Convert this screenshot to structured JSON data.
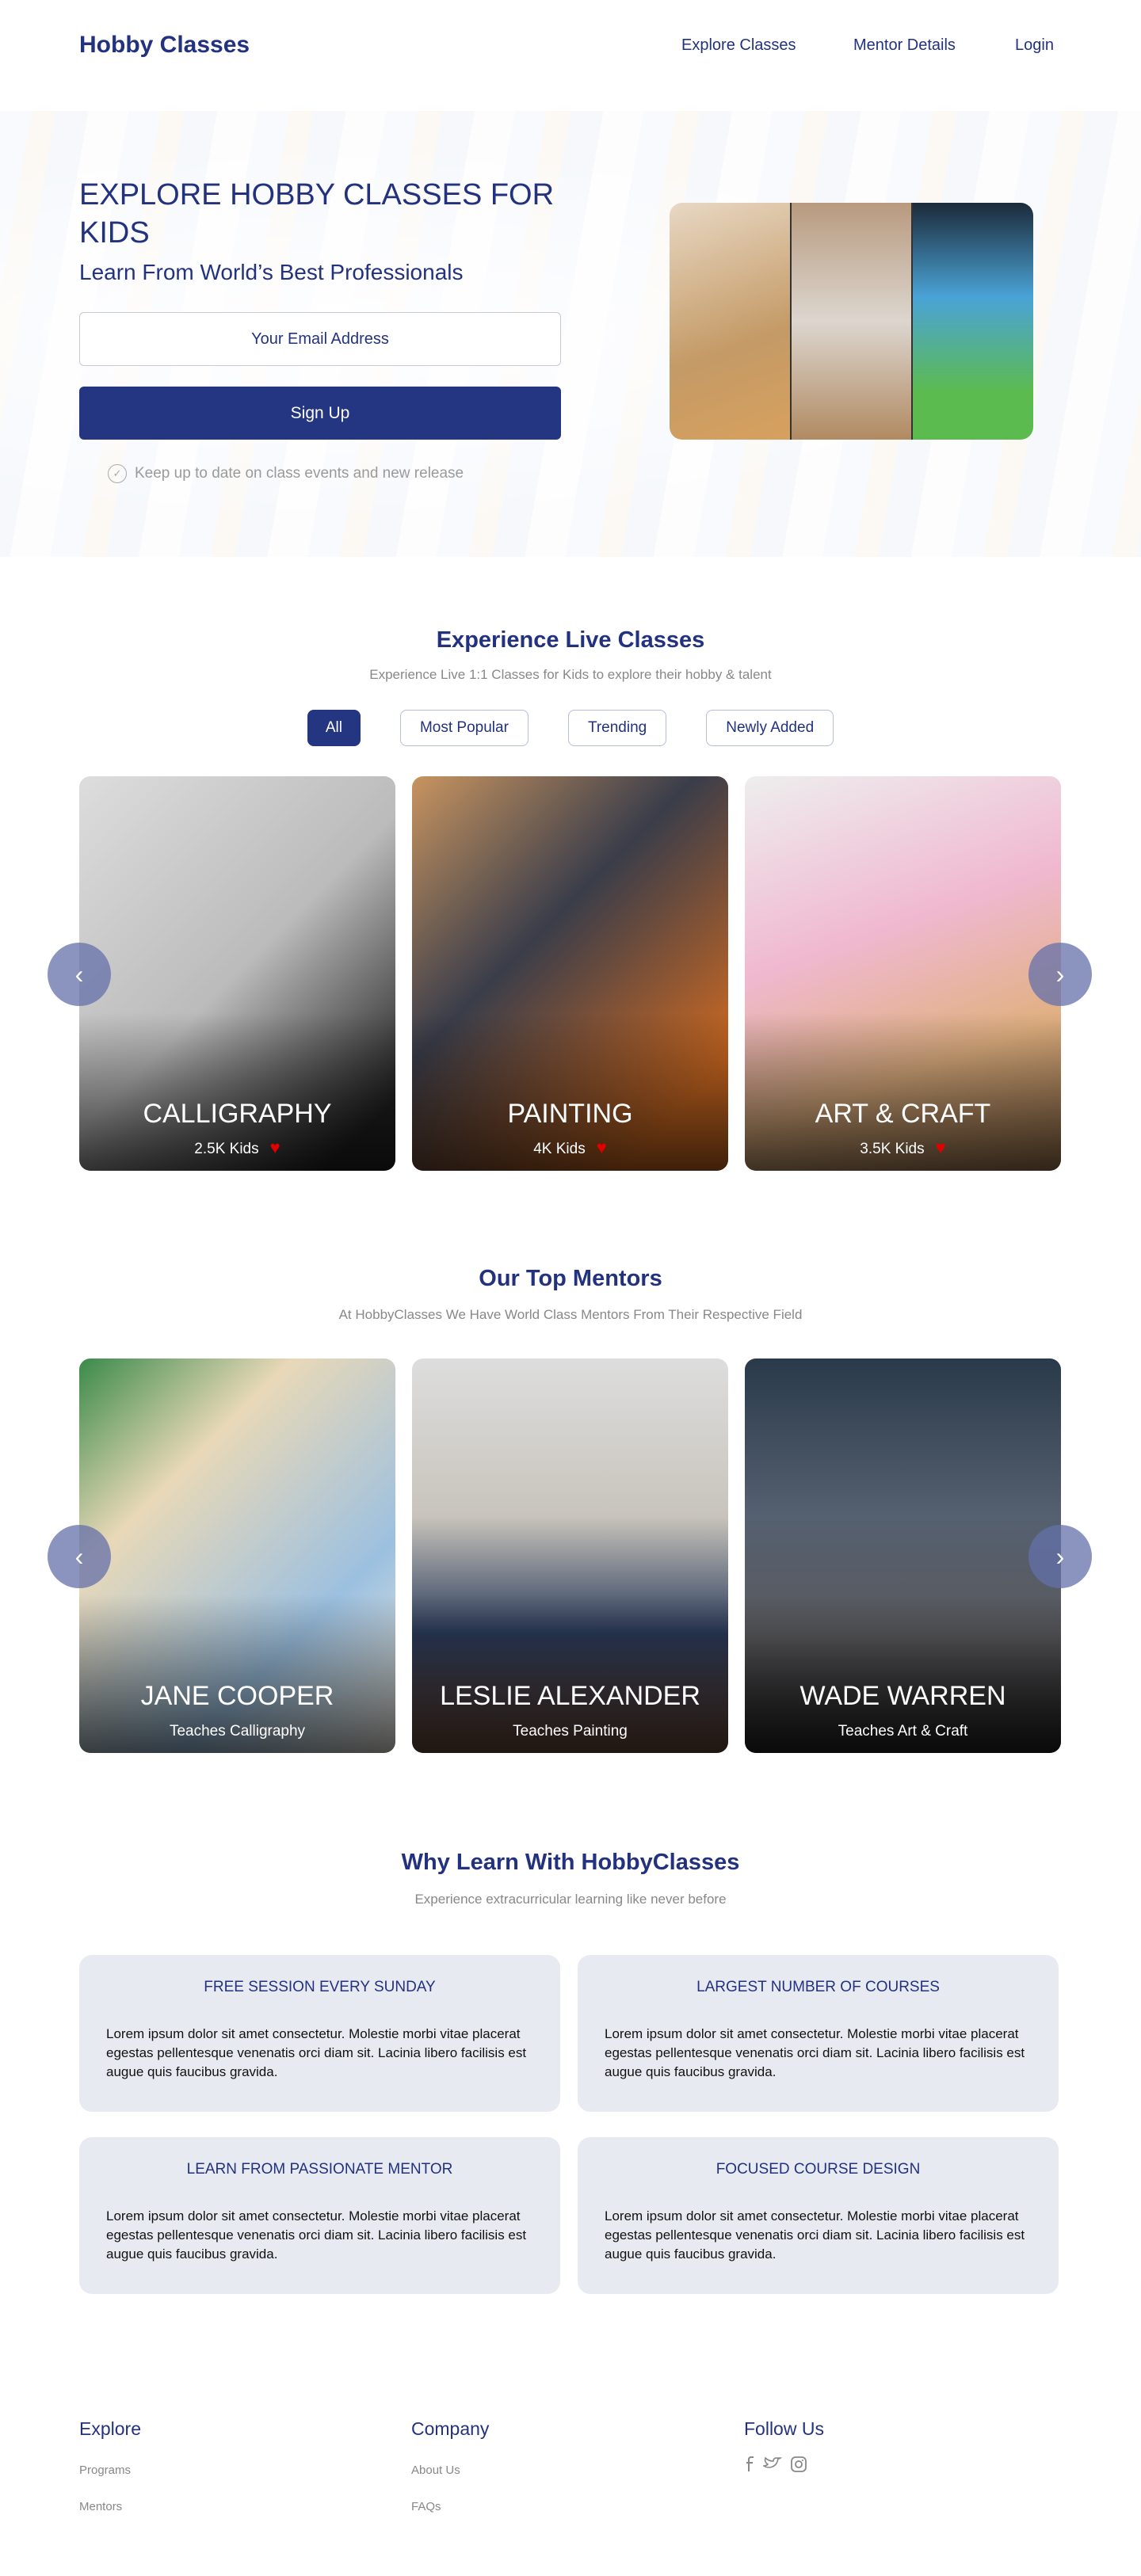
{
  "header": {
    "logo": "Hobby Classes",
    "nav": [
      "Explore Classes",
      "Mentor Details",
      "Login"
    ]
  },
  "hero": {
    "title": "EXPLORE HOBBY CLASSES FOR KIDS",
    "subtitle": "Learn From World’s Best Professionals",
    "email_placeholder": "Your Email Address",
    "signup_label": "Sign Up",
    "note": "Keep up to date on class events and new release"
  },
  "classes": {
    "title": "Experience Live Classes",
    "subtitle": "Experience Live 1:1 Classes for Kids to explore their hobby & talent",
    "filters": [
      "All",
      "Most Popular",
      "Trending",
      "Newly Added"
    ],
    "active_filter": "All",
    "cards": [
      {
        "title": "CALLIGRAPHY",
        "kids": "2.5K Kids"
      },
      {
        "title": "PAINTING",
        "kids": "4K Kids"
      },
      {
        "title": "ART & CRAFT",
        "kids": "3.5K Kids"
      }
    ]
  },
  "mentors": {
    "title": "Our Top Mentors",
    "subtitle": "At HobbyClasses We  Have World Class Mentors From Their Respective Field",
    "cards": [
      {
        "name": "JANE COOPER",
        "teaches": "Teaches Calligraphy"
      },
      {
        "name": "LESLIE ALEXANDER",
        "teaches": "Teaches Painting"
      },
      {
        "name": "WADE WARREN",
        "teaches": "Teaches Art & Craft"
      }
    ]
  },
  "why": {
    "title": "Why Learn With HobbyClasses",
    "subtitle": "Experience extracurricular learning like never before",
    "items": [
      {
        "title": "FREE SESSION EVERY SUNDAY",
        "text": "Lorem ipsum dolor sit amet consectetur. Molestie morbi vitae placerat egestas pellentesque venenatis orci diam sit. Lacinia libero facilisis est augue quis faucibus gravida."
      },
      {
        "title": "LARGEST NUMBER OF COURSES",
        "text": "Lorem ipsum dolor sit amet consectetur. Molestie morbi vitae placerat egestas pellentesque venenatis orci diam sit. Lacinia libero facilisis est augue quis faucibus gravida."
      },
      {
        "title": "LEARN FROM PASSIONATE MENTOR",
        "text": "Lorem ipsum dolor sit amet consectetur. Molestie morbi vitae placerat egestas pellentesque venenatis orci diam sit. Lacinia libero facilisis est augue quis faucibus gravida."
      },
      {
        "title": "FOCUSED COURSE DESIGN",
        "text": "Lorem ipsum dolor sit amet consectetur. Molestie morbi vitae placerat egestas pellentesque venenatis orci diam sit. Lacinia libero facilisis est augue quis faucibus gravida."
      }
    ]
  },
  "footer": {
    "explore": {
      "title": "Explore",
      "links": [
        "Programs",
        "Mentors"
      ]
    },
    "company": {
      "title": "Company",
      "links": [
        "About Us",
        "FAQs"
      ]
    },
    "follow": {
      "title": "Follow Us",
      "icons": [
        "facebook-icon",
        "twitter-icon",
        "instagram-icon"
      ]
    }
  },
  "colors": {
    "primary": "#243582",
    "heart": "#e30000",
    "box_bg": "#e8eaf1"
  }
}
